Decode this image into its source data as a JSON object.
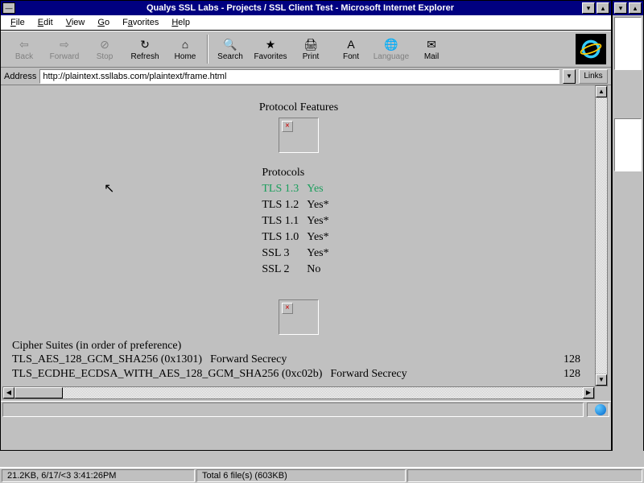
{
  "window": {
    "title": "Qualys SSL Labs - Projects / SSL Client Test - Microsoft Internet Explorer"
  },
  "menu": {
    "file": "File",
    "edit": "Edit",
    "view": "View",
    "go": "Go",
    "favorites": "Favorites",
    "help": "Help"
  },
  "toolbar": {
    "back": "Back",
    "forward": "Forward",
    "stop": "Stop",
    "refresh": "Refresh",
    "home": "Home",
    "search": "Search",
    "favorites": "Favorites",
    "print": "Print",
    "font": "Font",
    "language": "Language",
    "mail": "Mail"
  },
  "address": {
    "label": "Address",
    "url": "http://plaintext.ssllabs.com/plaintext/frame.html",
    "links": "Links"
  },
  "page": {
    "protocol_features_heading": "Protocol Features",
    "protocols_heading": "Protocols",
    "protocols": [
      {
        "name": "TLS 1.3",
        "value": "Yes",
        "green": true
      },
      {
        "name": "TLS 1.2",
        "value": "Yes*"
      },
      {
        "name": "TLS 1.1",
        "value": "Yes*"
      },
      {
        "name": "TLS 1.0",
        "value": "Yes*"
      },
      {
        "name": "SSL 3",
        "value": "Yes*"
      },
      {
        "name": "SSL 2",
        "value": "No"
      }
    ],
    "cipher_heading": "Cipher Suites (in order of preference)",
    "ciphers": [
      {
        "name": "TLS_AES_128_GCM_SHA256 (0x1301)",
        "note": "Forward Secrecy",
        "bits": "128"
      },
      {
        "name": "TLS_ECDHE_ECDSA_WITH_AES_128_GCM_SHA256 (0xc02b)",
        "note": "Forward Secrecy",
        "bits": "128"
      }
    ]
  },
  "status": {
    "left": "21.2KB, 6/17/<3 3:41:26PM",
    "mid": "Total 6 file(s) (603KB)"
  }
}
